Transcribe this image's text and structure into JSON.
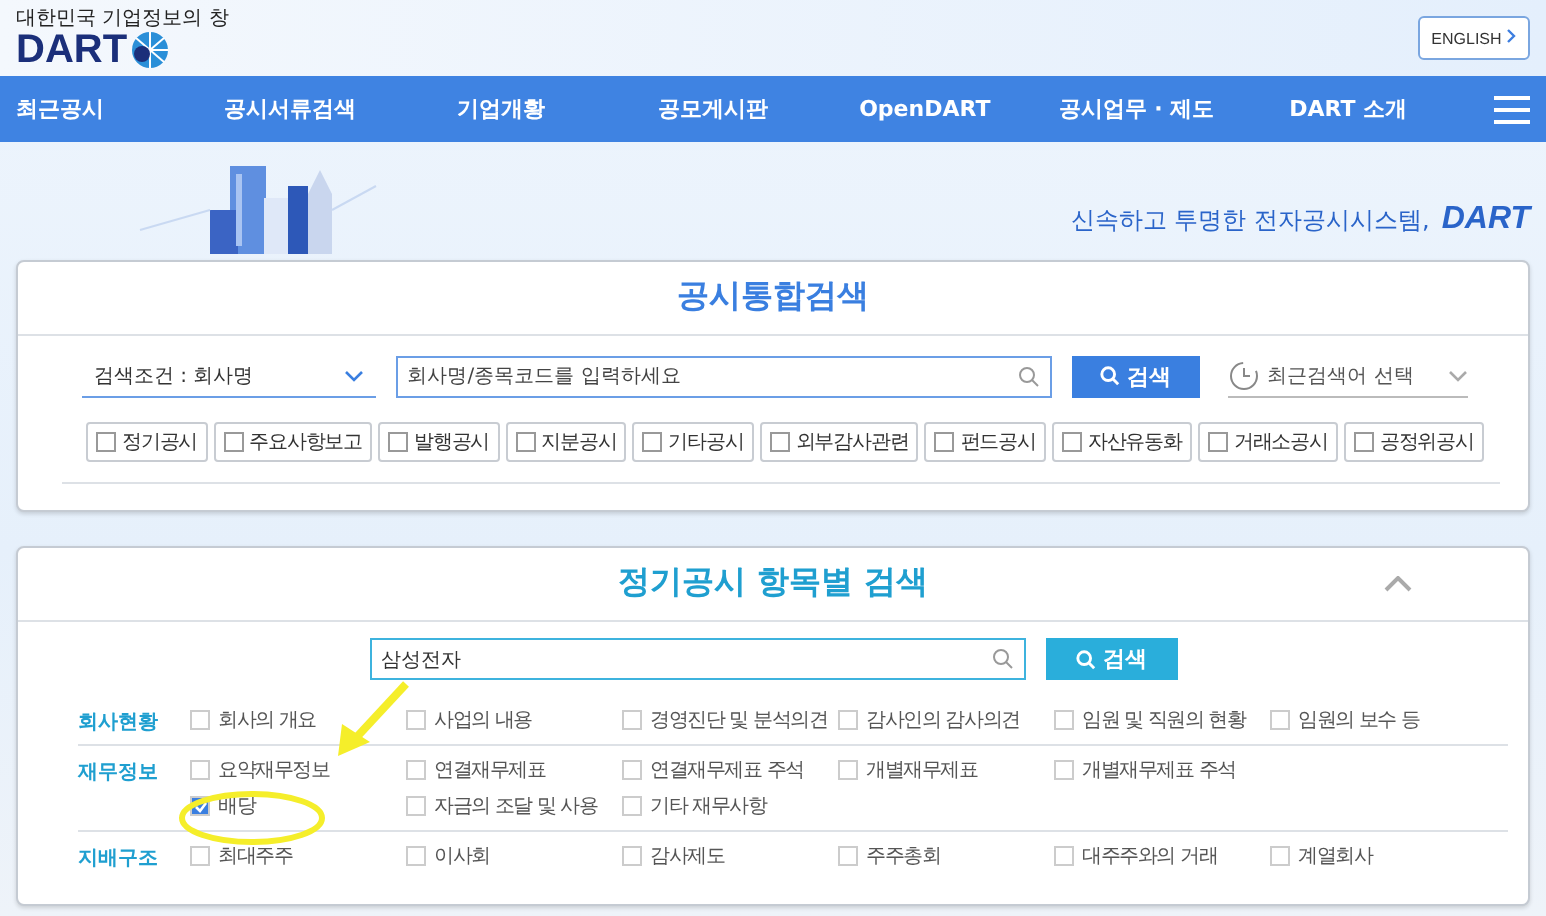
{
  "header": {
    "logo_tagline": "대한민국 기업정보의 창",
    "logo_text": "DART",
    "language_button": "ENGLISH"
  },
  "nav": [
    "최근공시",
    "공시서류검색",
    "기업개황",
    "공모게시판",
    "OpenDART",
    "공시업무 · 제도",
    "DART 소개"
  ],
  "banner": {
    "slogan": "신속하고 투명한 전자공시시스템,",
    "slogan_brand": "DART"
  },
  "integrated_search": {
    "title": "공시통합검색",
    "condition": "검색조건 : 회사명",
    "placeholder": "회사명/종목코드를 입력하세요",
    "button": "검색",
    "recent": "최근검색어 선택",
    "filters": [
      {
        "label": "정기공시",
        "checked": false
      },
      {
        "label": "주요사항보고",
        "checked": false
      },
      {
        "label": "발행공시",
        "checked": false
      },
      {
        "label": "지분공시",
        "checked": false
      },
      {
        "label": "기타공시",
        "checked": false
      },
      {
        "label": "외부감사관련",
        "checked": false
      },
      {
        "label": "펀드공시",
        "checked": false
      },
      {
        "label": "자산유동화",
        "checked": false
      },
      {
        "label": "거래소공시",
        "checked": false
      },
      {
        "label": "공정위공시",
        "checked": false
      }
    ]
  },
  "item_search": {
    "title": "정기공시 항목별 검색",
    "expanded": true,
    "value": "삼성전자",
    "button": "검색",
    "groups": [
      {
        "label": "회사현황",
        "lines": [
          [
            {
              "label": "회사의 개요",
              "checked": false
            },
            {
              "label": "사업의 내용",
              "checked": false
            },
            {
              "label": "경영진단 및 분석의견",
              "checked": false
            },
            {
              "label": "감사인의 감사의견",
              "checked": false
            },
            {
              "label": "임원 및 직원의 현황",
              "checked": false
            },
            {
              "label": "임원의 보수 등",
              "checked": false
            }
          ]
        ]
      },
      {
        "label": "재무정보",
        "lines": [
          [
            {
              "label": "요약재무정보",
              "checked": false
            },
            {
              "label": "연결재무제표",
              "checked": false
            },
            {
              "label": "연결재무제표 주석",
              "checked": false
            },
            {
              "label": "개별재무제표",
              "checked": false
            },
            {
              "label": "개별재무제표 주석",
              "checked": false
            }
          ],
          [
            {
              "label": "배당",
              "checked": true
            },
            {
              "label": "자금의 조달 및 사용",
              "checked": false
            },
            {
              "label": "기타 재무사항",
              "checked": false
            }
          ]
        ]
      },
      {
        "label": "지배구조",
        "lines": [
          [
            {
              "label": "최대주주",
              "checked": false
            },
            {
              "label": "이사회",
              "checked": false
            },
            {
              "label": "감사제도",
              "checked": false
            },
            {
              "label": "주주총회",
              "checked": false
            },
            {
              "label": "대주주와의 거래",
              "checked": false
            },
            {
              "label": "계열회사",
              "checked": false
            }
          ]
        ]
      }
    ]
  }
}
